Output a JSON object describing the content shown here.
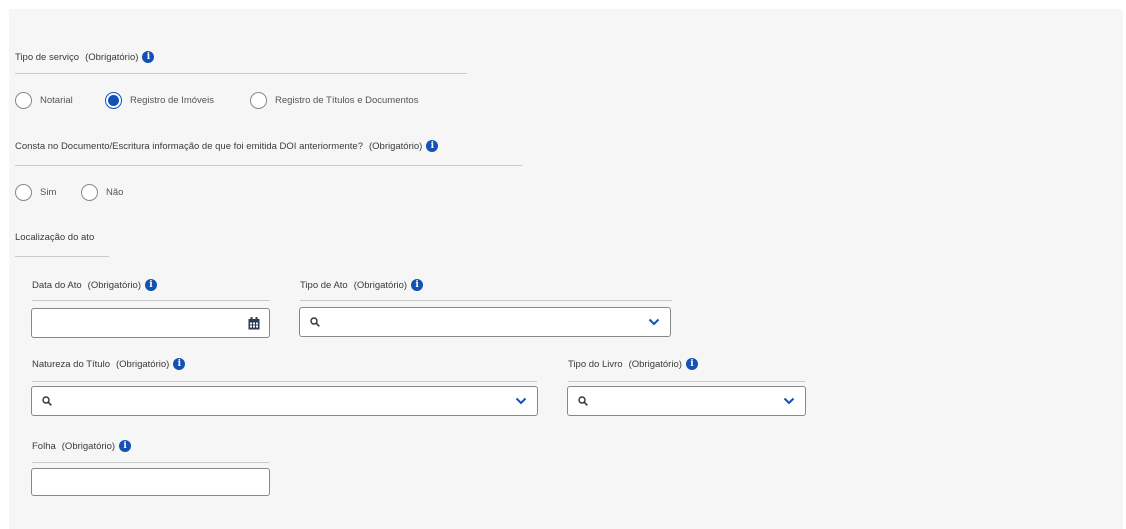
{
  "service_type": {
    "label": "Tipo de serviço",
    "required": "(Obrigatório)",
    "options": [
      {
        "label": "Notarial",
        "checked": false
      },
      {
        "label": "Registro de Imóveis",
        "checked": true
      },
      {
        "label": "Registro de Títulos e Documentos",
        "checked": false
      }
    ]
  },
  "doi_question": {
    "label": "Consta no Documento/Escritura informação de que foi emitida DOI anteriormente?",
    "required": "(Obrigatório)",
    "options": [
      {
        "label": "Sim",
        "checked": false
      },
      {
        "label": "Não",
        "checked": false
      }
    ]
  },
  "location_section": {
    "title": "Localização do ato"
  },
  "fields": {
    "data_ato": {
      "label": "Data do Ato",
      "required": "(Obrigatório)",
      "value": "",
      "icon": "calendar-icon"
    },
    "tipo_ato": {
      "label": "Tipo de Ato",
      "required": "(Obrigatório)",
      "value": "",
      "icon": "search-icon"
    },
    "natureza_titulo": {
      "label": "Natureza do Título",
      "required": "(Obrigatório)",
      "value": "",
      "icon": "search-icon"
    },
    "tipo_livro": {
      "label": "Tipo do Livro",
      "required": "(Obrigatório)",
      "value": "",
      "icon": "search-icon"
    },
    "folha": {
      "label": "Folha",
      "required": "(Obrigatório)",
      "value": ""
    }
  },
  "colors": {
    "primary": "#1351b4",
    "background": "#f6f6f6",
    "border": "#888888"
  }
}
